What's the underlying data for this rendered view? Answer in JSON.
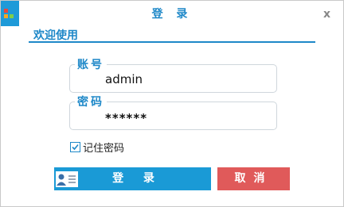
{
  "window": {
    "title": "登 录",
    "close_glyph": "x",
    "app_icon": "app-logo-icon"
  },
  "welcome": "欢迎使用",
  "username": {
    "label": "账号",
    "value": "admin"
  },
  "password": {
    "label": "密码",
    "value": "******"
  },
  "remember": {
    "label": "记住密码",
    "checked": true
  },
  "buttons": {
    "login": "登 录",
    "login_icon": "user-card-icon",
    "cancel": "取消"
  },
  "colors": {
    "accent": "#1e88c8",
    "login_button": "#1a9ad6",
    "cancel_button": "#e05a5a"
  }
}
